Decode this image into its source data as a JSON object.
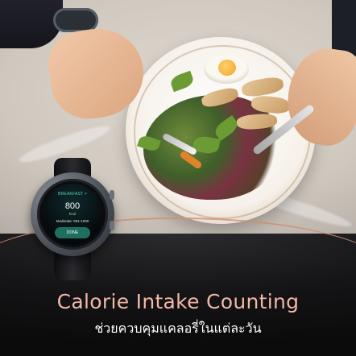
{
  "watch_screen": {
    "title": "BREAKFAST >",
    "calories": "800",
    "unit": "kcal",
    "range": "Moderate: 501-1000",
    "done_label": "DONE"
  },
  "banner": {
    "headline": "Calorie Intake Counting",
    "subline": "ช่วยควบคุมแคลอรี่ในแต่ละวัน"
  },
  "colors": {
    "accent_teal": "#52d3c7",
    "done_button": "#1f6f61",
    "headline_gradient": "#f2b8a8"
  }
}
